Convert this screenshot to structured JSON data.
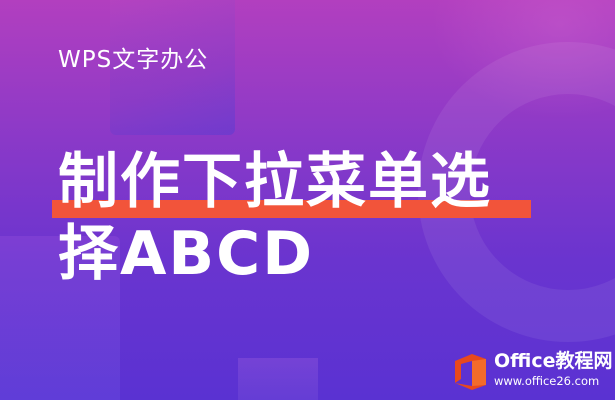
{
  "banner": {
    "subtitle": "WPS文字办公",
    "title_line1": "制作下拉菜单选",
    "title_line2": "择ABCD",
    "accent_color": "#f2543a",
    "background_colors": [
      "#b23fbf",
      "#5a32d2"
    ]
  },
  "logo": {
    "icon": "office-logo-icon",
    "name": "Office教程网",
    "url": "www.office26.com",
    "color": "#e8491d"
  }
}
